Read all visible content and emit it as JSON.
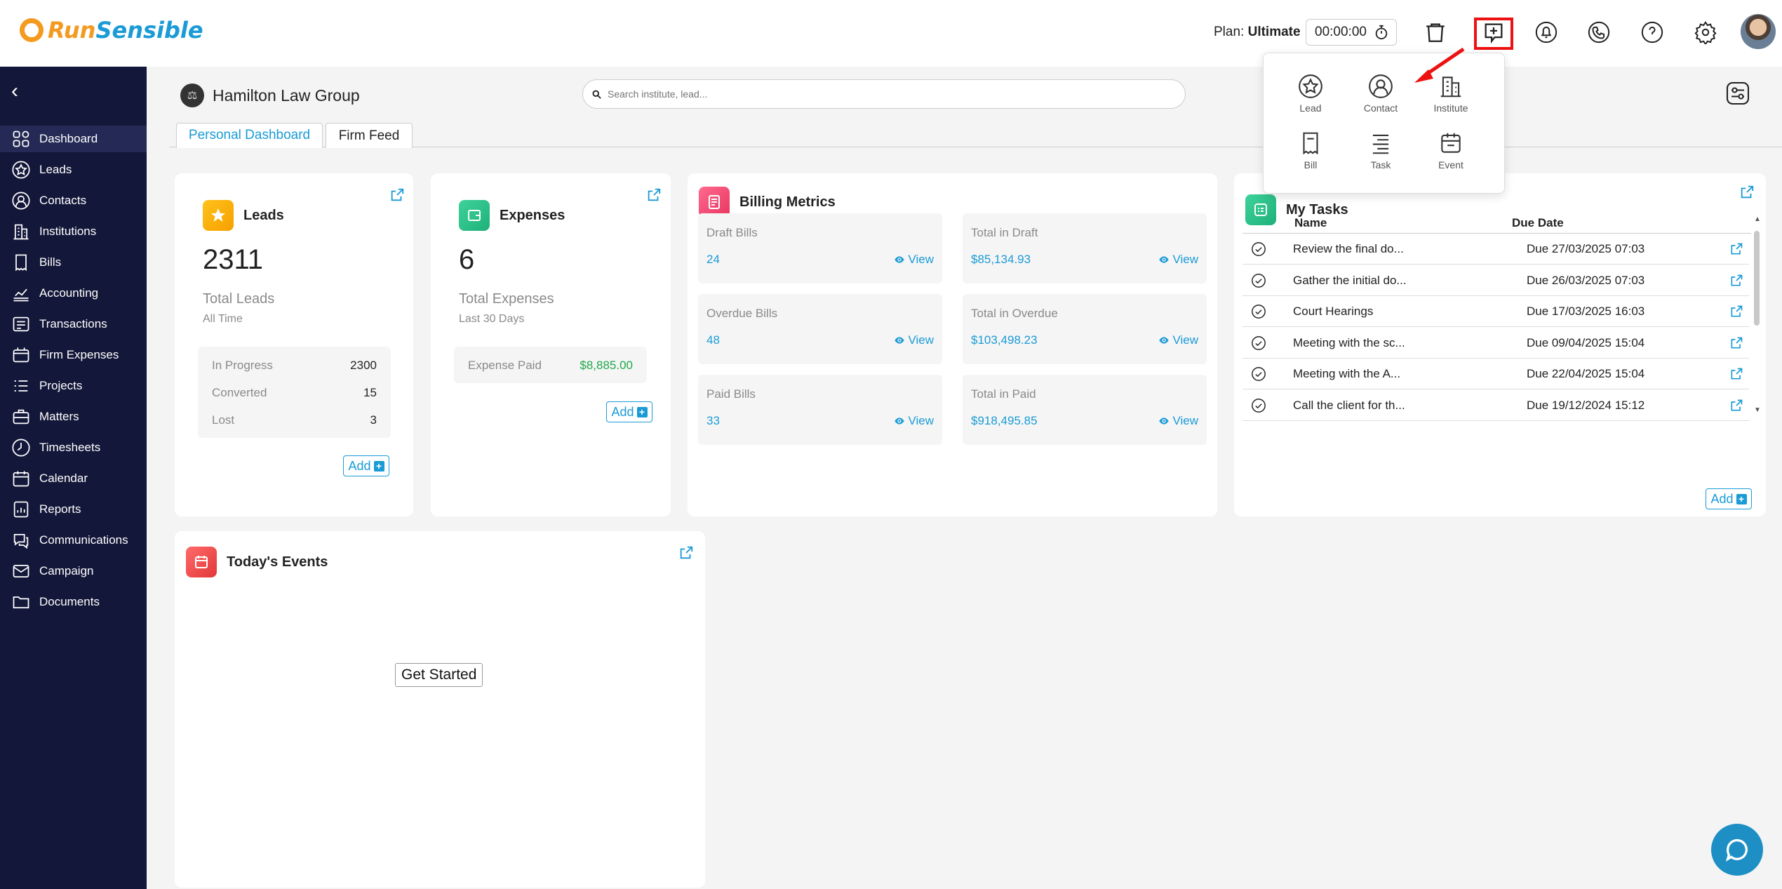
{
  "logo": {
    "part1": "Run",
    "part2": "Sensible"
  },
  "header": {
    "plan_label": "Plan:",
    "plan_value": "Ultimate",
    "timer": "00:00:00"
  },
  "sidebar": {
    "items": [
      {
        "label": "Dashboard",
        "icon": "dashboard-icon"
      },
      {
        "label": "Leads",
        "icon": "star-icon"
      },
      {
        "label": "Contacts",
        "icon": "contact-icon"
      },
      {
        "label": "Institutions",
        "icon": "building-icon"
      },
      {
        "label": "Bills",
        "icon": "bill-icon"
      },
      {
        "label": "Accounting",
        "icon": "accounting-icon"
      },
      {
        "label": "Transactions",
        "icon": "transactions-icon"
      },
      {
        "label": "Firm Expenses",
        "icon": "firm-expenses-icon"
      },
      {
        "label": "Projects",
        "icon": "projects-icon"
      },
      {
        "label": "Matters",
        "icon": "matters-icon"
      },
      {
        "label": "Timesheets",
        "icon": "clock-icon"
      },
      {
        "label": "Calendar",
        "icon": "calendar-icon"
      },
      {
        "label": "Reports",
        "icon": "reports-icon"
      },
      {
        "label": "Communications",
        "icon": "communications-icon"
      },
      {
        "label": "Campaign",
        "icon": "campaign-icon"
      },
      {
        "label": "Documents",
        "icon": "folder-icon"
      }
    ]
  },
  "main": {
    "firm_name": "Hamilton Law Group",
    "search_placeholder": "Search institute, lead...",
    "tabs": [
      "Personal Dashboard",
      "Firm Feed"
    ]
  },
  "leads_card": {
    "title": "Leads",
    "total": "2311",
    "subtitle": "Total Leads",
    "period": "All Time",
    "stats": [
      {
        "label": "In Progress",
        "value": "2300"
      },
      {
        "label": "Converted",
        "value": "15"
      },
      {
        "label": "Lost",
        "value": "3"
      }
    ],
    "add_label": "Add"
  },
  "expenses_card": {
    "title": "Expenses",
    "total": "6",
    "subtitle": "Total Expenses",
    "period": "Last 30 Days",
    "paid_label": "Expense Paid",
    "paid_value": "$8,885.00",
    "add_label": "Add"
  },
  "billing_card": {
    "title": "Billing Metrics",
    "view_label": "View",
    "boxes": [
      {
        "label": "Draft Bills",
        "value": "24"
      },
      {
        "label": "Total in Draft",
        "value": "$85,134.93"
      },
      {
        "label": "Overdue Bills",
        "value": "48"
      },
      {
        "label": "Total in Overdue",
        "value": "$103,498.23"
      },
      {
        "label": "Paid Bills",
        "value": "33"
      },
      {
        "label": "Total in Paid",
        "value": "$918,495.85"
      }
    ]
  },
  "tasks_card": {
    "title": "My Tasks",
    "col_name": "Name",
    "col_due": "Due Date",
    "rows": [
      {
        "name": "Review the final do...",
        "due": "Due 27/03/2025 07:03"
      },
      {
        "name": "Gather the initial do...",
        "due": "Due 26/03/2025 07:03"
      },
      {
        "name": "Court Hearings",
        "due": "Due 17/03/2025 16:03"
      },
      {
        "name": "Meeting with the sc...",
        "due": "Due 09/04/2025 15:04"
      },
      {
        "name": "Meeting with the A...",
        "due": "Due 22/04/2025 15:04"
      },
      {
        "name": "Call the client for th...",
        "due": "Due 19/12/2024 15:12"
      }
    ],
    "add_label": "Add"
  },
  "events_card": {
    "title": "Today's Events",
    "button": "Get Started"
  },
  "quick_menu": {
    "items": [
      {
        "label": "Lead",
        "icon": "star-icon"
      },
      {
        "label": "Contact",
        "icon": "contact-icon"
      },
      {
        "label": "Institute",
        "icon": "building-icon"
      },
      {
        "label": "Bill",
        "icon": "bill-icon"
      },
      {
        "label": "Task",
        "icon": "task-icon"
      },
      {
        "label": "Event",
        "icon": "calendar-icon"
      }
    ]
  },
  "colors": {
    "sidebar_bg": "#131739",
    "accent": "#1a9bd6",
    "highlight_box": "#e11111",
    "brand_orange": "#f39a1f"
  }
}
